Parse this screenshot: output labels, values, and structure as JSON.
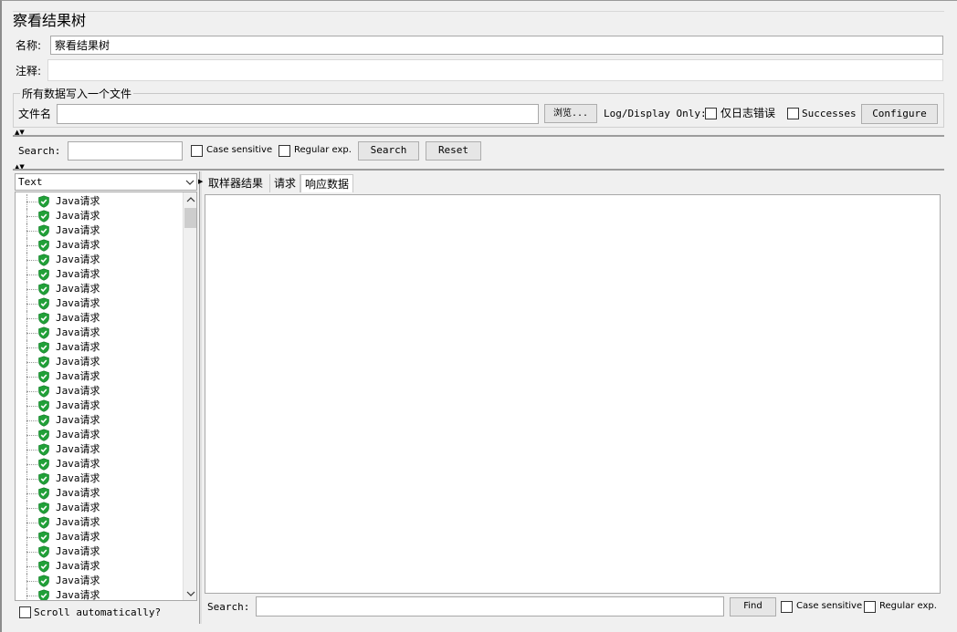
{
  "title": "察看结果树",
  "name_label": "名称:",
  "name_value": "察看结果树",
  "comment_label": "注释:",
  "comment_value": "",
  "file_group": {
    "legend": "所有数据写入一个文件",
    "filename_label": "文件名",
    "filename_value": "",
    "browse_label": "浏览...",
    "log_display_label": "Log/Display Only:",
    "errors_label": "仅日志错误",
    "successes_label": "Successes",
    "configure_label": "Configure"
  },
  "search_bar": {
    "label": "Search:",
    "value": "",
    "case_sensitive_label": "Case sensitive",
    "regex_label": "Regular exp.",
    "search_label": "Search",
    "reset_label": "Reset"
  },
  "renderer_select": {
    "selected": "Text"
  },
  "tree": {
    "items": [
      "Java请求",
      "Java请求",
      "Java请求",
      "Java请求",
      "Java请求",
      "Java请求",
      "Java请求",
      "Java请求",
      "Java请求",
      "Java请求",
      "Java请求",
      "Java请求",
      "Java请求",
      "Java请求",
      "Java请求",
      "Java请求",
      "Java请求",
      "Java请求",
      "Java请求",
      "Java请求",
      "Java请求",
      "Java请求",
      "Java请求",
      "Java请求",
      "Java请求",
      "Java请求",
      "Java请求",
      "Java请求"
    ]
  },
  "scroll_auto_label": "Scroll automatically?",
  "tabs": [
    "取样器结果",
    "请求",
    "响应数据"
  ],
  "active_tab": 2,
  "bottom_search": {
    "label": "Search:",
    "value": "",
    "find_label": "Find",
    "case_sensitive_label": "Case sensitive",
    "regex_label": "Regular exp."
  },
  "colors": {
    "success_icon": "#21a038"
  },
  "icons": {
    "tree_item": "green-shield-check-icon"
  }
}
